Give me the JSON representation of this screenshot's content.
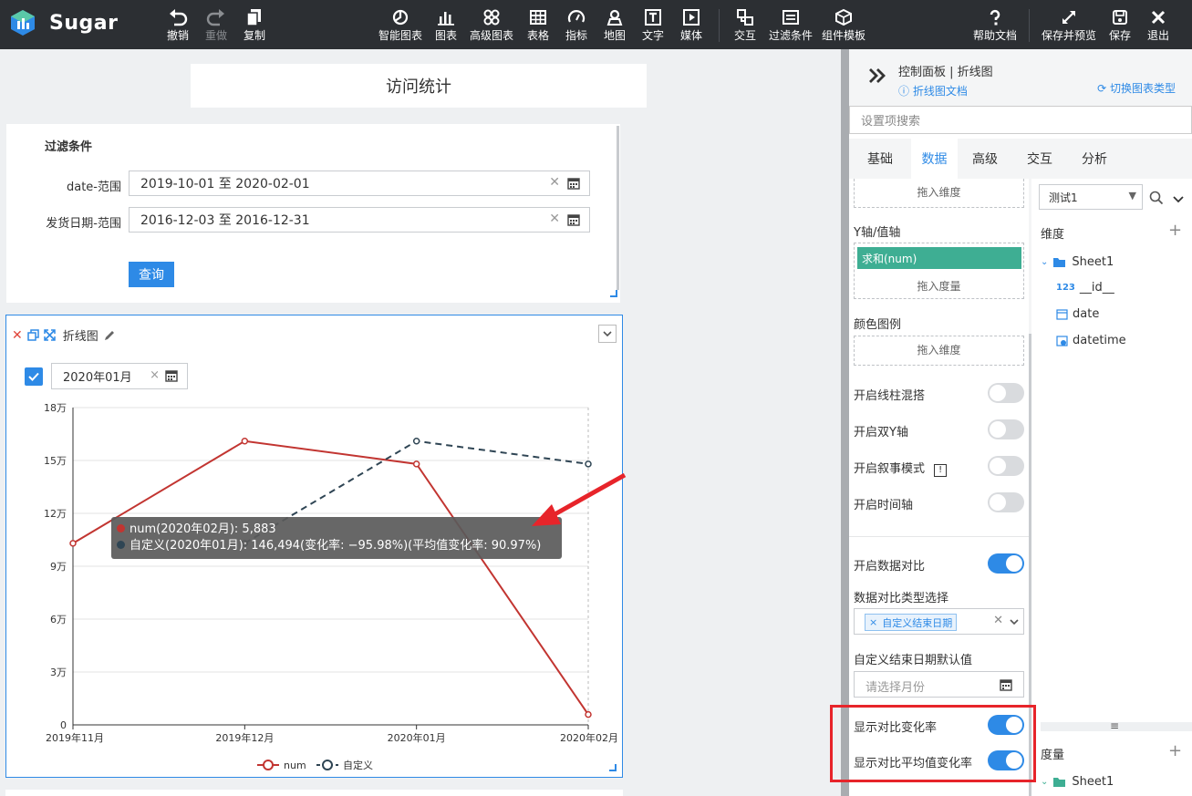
{
  "toolbar": {
    "brand": "Sugar",
    "undo": "撤销",
    "redo": "重做",
    "copy": "复制",
    "smart_chart": "智能图表",
    "chart": "图表",
    "adv_chart": "高级图表",
    "table": "表格",
    "indicator": "指标",
    "map": "地图",
    "text": "文字",
    "media": "媒体",
    "interact": "交互",
    "filter": "过滤条件",
    "template": "组件模板",
    "help": "帮助文档",
    "save_preview": "保存并预览",
    "save": "保存",
    "exit": "退出"
  },
  "canvas": {
    "title": "访问统计",
    "filter": {
      "title": "过滤条件",
      "row1_label": "date-范围",
      "row1_value": "2019-10-01 至 2020-02-01",
      "row2_label": "发货日期-范围",
      "row2_value": "2016-12-03 至 2016-12-31",
      "query": "查询"
    },
    "chart_card": {
      "title": "折线图",
      "month_value": "2020年01月",
      "clear": "×"
    },
    "tooltip": {
      "line1": "num(2020年02月): 5,883",
      "line2": "自定义(2020年01月): 146,494(变化率: −95.98%)(平均值变化率: 90.97%)",
      "color1": "#c23531",
      "color2": "#2f4554"
    }
  },
  "chart_data": {
    "type": "line",
    "categories": [
      "2019年11月",
      "2019年12月",
      "2020年01月",
      "2020年02月"
    ],
    "yticks": [
      "0",
      "3万",
      "6万",
      "9万",
      "12万",
      "15万",
      "18万"
    ],
    "ylim": [
      0,
      180000
    ],
    "series": [
      {
        "name": "num",
        "color": "#c23531",
        "dashed": false,
        "values": [
          103000,
          161000,
          148000,
          5883
        ]
      },
      {
        "name": "自定义",
        "color": "#2f4554",
        "dashed": true,
        "values": [
          null,
          103000,
          161000,
          148000
        ]
      }
    ],
    "legend_position": "bottom",
    "grid": true
  },
  "panel": {
    "title": "控制面板 | 折线图",
    "doc_link": "折线图文档",
    "switch_type": "切换图表类型",
    "search_placeholder": "设置项搜索",
    "tabs": [
      "基础",
      "数据",
      "高级",
      "交互",
      "分析"
    ],
    "drop_dimension": "拖入维度",
    "y_axis_label": "Y轴/值轴",
    "y_chip": "求和(num)",
    "drop_measure": "拖入度量",
    "color_legend": "颜色图例",
    "drop_dimension2": "拖入维度",
    "opt_mix": "开启线柱混搭",
    "opt_dual_y": "开启双Y轴",
    "opt_story": "开启叙事模式",
    "opt_timeline": "开启时间轴",
    "opt_compare": "开启数据对比",
    "compare_type_label": "数据对比类型选择",
    "compare_tag": "自定义结束日期",
    "end_date_label": "自定义结束日期默认值",
    "month_placeholder": "请选择月份",
    "show_rate": "显示对比变化率",
    "show_avg_rate": "显示对比平均值变化率",
    "dataset": "测试1",
    "dimension": "维度",
    "sheet": "Sheet1",
    "field_id": "__id__",
    "field_date": "date",
    "field_datetime": "datetime",
    "measure": "度量",
    "sheet2": "Sheet1"
  },
  "colors": {
    "accent": "#2e8ae6",
    "topbar": "#2c2f33",
    "chip": "#3eae93",
    "highlight": "#e7242a"
  }
}
